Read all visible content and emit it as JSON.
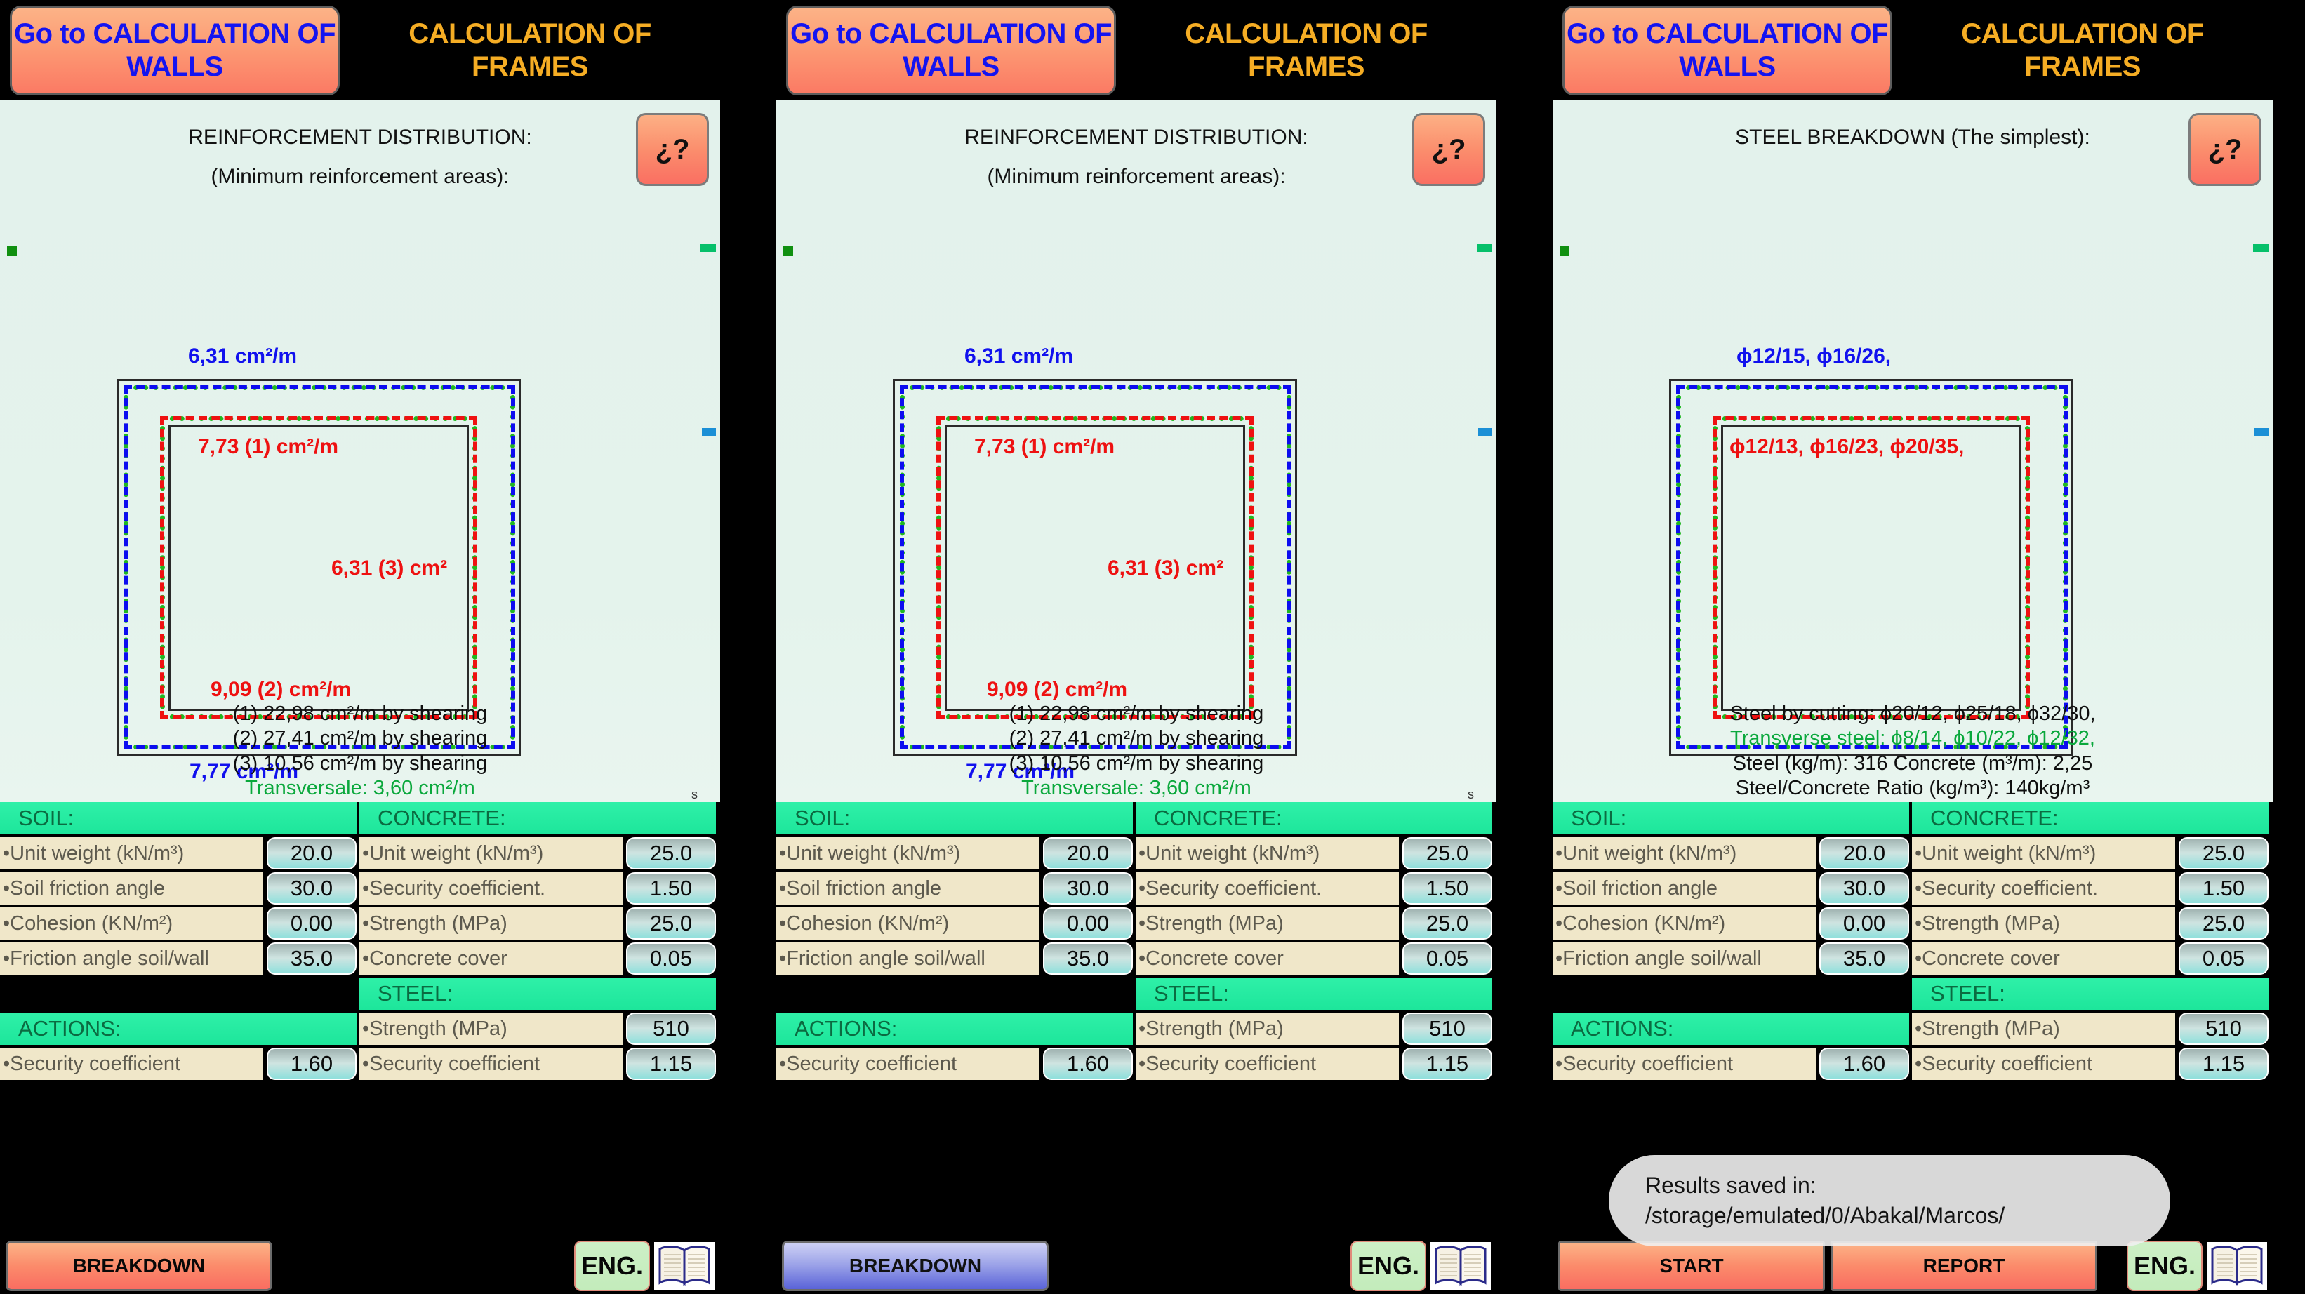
{
  "header": {
    "walls_button": "Go to CALCULATION OF WALLS",
    "frames_button": "CALCULATION OF FRAMES",
    "help_label": "¿?"
  },
  "panels": [
    {
      "caption_1": "REINFORCEMENT DISTRIBUTION:",
      "caption_2": "(Minimum reinforcement areas):",
      "diagram": {
        "top_label": "6,31 cm²/m",
        "inner_top_label": "7,73 (1) cm²/m",
        "center_label": "6,31 (3) cm²",
        "inner_bottom_label": "9,09 (2) cm²/m",
        "bottom_label": "7,77 cm²/m"
      },
      "notes": [
        "(1) 22,98 cm²/m by shearing",
        "(2) 27,41 cm²/m by shearing",
        "(3) 10,56 cm²/m by shearing"
      ],
      "note_green": "Transversale: 3,60 cm²/m",
      "corner_mark": "s",
      "footer": {
        "main_button": "BREAKDOWN",
        "lang_button": "ENG.",
        "style": "orange"
      }
    },
    {
      "caption_1": "REINFORCEMENT DISTRIBUTION:",
      "caption_2": "(Minimum reinforcement areas):",
      "diagram": {
        "top_label": "6,31 cm²/m",
        "inner_top_label": "7,73 (1) cm²/m",
        "center_label": "6,31 (3) cm²",
        "inner_bottom_label": "9,09 (2) cm²/m",
        "bottom_label": "7,77 cm²/m"
      },
      "notes": [
        "(1) 22,98 cm²/m by shearing",
        "(2) 27,41 cm²/m by shearing",
        "(3) 10,56 cm²/m by shearing"
      ],
      "note_green": "Transversale: 3,60 cm²/m",
      "corner_mark": "s",
      "footer": {
        "main_button": "BREAKDOWN",
        "lang_button": "ENG.",
        "style": "purple"
      }
    },
    {
      "caption_1": "STEEL BREAKDOWN (The simplest):",
      "caption_2": "",
      "diagram": {
        "top_label": "ϕ12/15, ϕ16/26,",
        "inner_top_label": "ϕ12/13, ϕ16/23, ϕ20/35,",
        "center_label": "",
        "inner_bottom_label": "",
        "bottom_label": ""
      },
      "notes": [
        "Steel by cutting: ϕ20/12, ϕ25/18, ϕ32/30,",
        "Steel (kg/m): 316 Concrete (m³/m): 2,25",
        "Steel/Concrete Ratio (kg/m³): 140kg/m³"
      ],
      "note_green": "Transverse steel: ϕ8/14, ϕ10/22, ϕ12/32,",
      "corner_mark": "",
      "footer": {
        "main_button": "START",
        "second_button": "REPORT",
        "lang_button": "ENG.",
        "style": "orange"
      },
      "toast": {
        "line_1": "Results saved in:",
        "line_2": "/storage/emulated/0/Abakal/Marcos/"
      }
    }
  ],
  "table": {
    "soil_header": "SOIL:",
    "concrete_header": "CONCRETE:",
    "steel_header": "STEEL:",
    "actions_header": "ACTIONS:",
    "soil_rows": [
      {
        "name": "•Unit weight (kN/m³)",
        "value": "20.0"
      },
      {
        "name": "•Soil friction angle",
        "value": "30.0"
      },
      {
        "name": "•Cohesion (KN/m²)",
        "value": "0.00"
      },
      {
        "name": "•Friction angle soil/wall",
        "value": "35.0"
      }
    ],
    "concrete_rows": [
      {
        "name": "•Unit weight (kN/m³)",
        "value": "25.0"
      },
      {
        "name": "•Security coefficient.",
        "value": "1.50"
      },
      {
        "name": "•Strength (MPa)",
        "value": "25.0"
      },
      {
        "name": "•Concrete cover",
        "value": "0.05"
      }
    ],
    "steel_rows": [
      {
        "name": "•Strength (MPa)",
        "value": "510"
      },
      {
        "name": "•Security coefficient",
        "value": "1.15"
      }
    ],
    "actions_rows": [
      {
        "name": "•Security coefficient",
        "value": "1.60"
      }
    ]
  },
  "colors": {
    "accent_orange": "#fb8b6b",
    "accent_green": "#1de69b",
    "blue_text": "#1111ee",
    "red_text": "#ee1111",
    "green_text": "#0aa83c",
    "canvas_bg": "#e4f3ec",
    "row_bg": "#f0e7c9"
  }
}
